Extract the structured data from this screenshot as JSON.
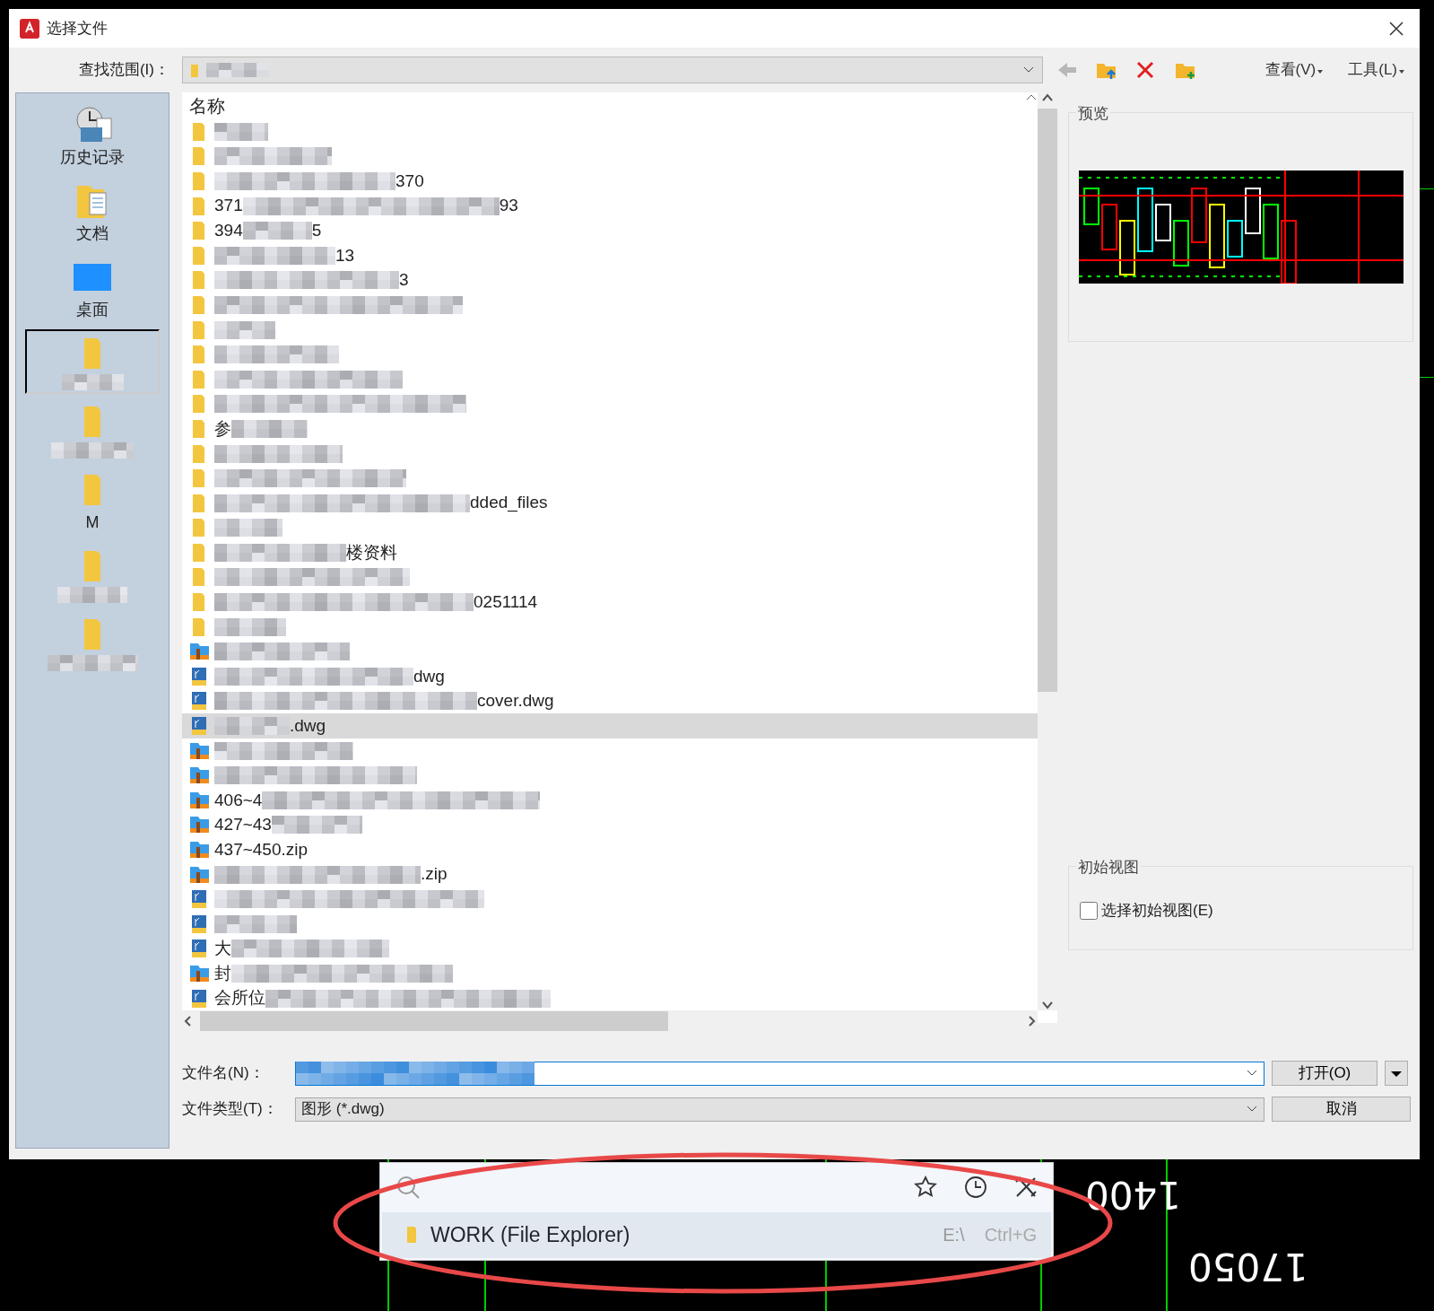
{
  "window": {
    "title": "选择文件"
  },
  "look_in": {
    "label": "查找范围(I)：",
    "value_blurred": true
  },
  "toolbar": {
    "buttons": [
      {
        "kind": "back",
        "disabled": true
      },
      {
        "kind": "up"
      },
      {
        "kind": "delete"
      },
      {
        "kind": "new-folder"
      }
    ],
    "menus": [
      {
        "label": "查看(V)"
      },
      {
        "label": "工具(L)"
      }
    ]
  },
  "sidebar": {
    "items": [
      {
        "kind": "history",
        "label": "历史记录",
        "selected": false
      },
      {
        "kind": "documents",
        "label": "文档",
        "selected": false
      },
      {
        "kind": "desktop",
        "label": "桌面",
        "selected": false
      },
      {
        "kind": "folder",
        "selected": true
      },
      {
        "kind": "folder",
        "selected": false
      },
      {
        "kind": "folder",
        "selected": false,
        "label": "M"
      },
      {
        "kind": "folder",
        "selected": false
      },
      {
        "kind": "folder",
        "selected": false
      }
    ]
  },
  "file_list": {
    "columns": [
      "名称"
    ],
    "rows": [
      {
        "kind": "folder",
        "selected": false,
        "segments": [
          {
            "kind": "blur"
          }
        ]
      },
      {
        "kind": "folder",
        "selected": false,
        "segments": [
          {
            "kind": "blur"
          }
        ]
      },
      {
        "kind": "folder",
        "selected": false,
        "segments": [
          {
            "kind": "blur"
          },
          {
            "kind": "text",
            "text": "370"
          }
        ]
      },
      {
        "kind": "folder",
        "selected": false,
        "segments": [
          {
            "kind": "text",
            "text": "371"
          },
          {
            "kind": "blur"
          },
          {
            "kind": "text",
            "text": "93"
          }
        ]
      },
      {
        "kind": "folder",
        "selected": false,
        "segments": [
          {
            "kind": "text",
            "text": "394"
          },
          {
            "kind": "blur"
          },
          {
            "kind": "text",
            "text": "5"
          }
        ]
      },
      {
        "kind": "folder",
        "selected": false,
        "segments": [
          {
            "kind": "blur"
          },
          {
            "kind": "text",
            "text": "13"
          }
        ]
      },
      {
        "kind": "folder",
        "selected": false,
        "segments": [
          {
            "kind": "blur"
          },
          {
            "kind": "text",
            "text": "3"
          }
        ]
      },
      {
        "kind": "folder",
        "selected": false,
        "segments": [
          {
            "kind": "blur"
          }
        ]
      },
      {
        "kind": "folder",
        "selected": false,
        "segments": [
          {
            "kind": "blur"
          }
        ]
      },
      {
        "kind": "folder",
        "selected": false,
        "segments": [
          {
            "kind": "blur"
          }
        ]
      },
      {
        "kind": "folder",
        "selected": false,
        "segments": [
          {
            "kind": "blur"
          }
        ]
      },
      {
        "kind": "folder",
        "selected": false,
        "segments": [
          {
            "kind": "blur"
          }
        ]
      },
      {
        "kind": "folder",
        "selected": false,
        "segments": [
          {
            "kind": "text",
            "text": "参"
          },
          {
            "kind": "blur"
          }
        ]
      },
      {
        "kind": "folder",
        "selected": false,
        "segments": [
          {
            "kind": "blur"
          }
        ]
      },
      {
        "kind": "folder",
        "selected": false,
        "segments": [
          {
            "kind": "blur"
          }
        ]
      },
      {
        "kind": "folder",
        "selected": false,
        "segments": [
          {
            "kind": "blur"
          },
          {
            "kind": "text",
            "text": "dded_files"
          }
        ]
      },
      {
        "kind": "folder",
        "selected": false,
        "segments": [
          {
            "kind": "blur"
          }
        ]
      },
      {
        "kind": "folder",
        "selected": false,
        "segments": [
          {
            "kind": "blur"
          },
          {
            "kind": "text",
            "text": "楼资料"
          }
        ]
      },
      {
        "kind": "folder",
        "selected": false,
        "segments": [
          {
            "kind": "blur"
          }
        ]
      },
      {
        "kind": "folder",
        "selected": false,
        "segments": [
          {
            "kind": "blur"
          },
          {
            "kind": "text",
            "text": "0251114"
          }
        ]
      },
      {
        "kind": "folder",
        "selected": false,
        "segments": [
          {
            "kind": "blur"
          }
        ]
      },
      {
        "kind": "zip",
        "selected": false,
        "segments": [
          {
            "kind": "blur"
          }
        ]
      },
      {
        "kind": "dwg",
        "selected": false,
        "segments": [
          {
            "kind": "blur"
          },
          {
            "kind": "text",
            "text": "dwg"
          }
        ]
      },
      {
        "kind": "dwg",
        "selected": false,
        "segments": [
          {
            "kind": "blur"
          },
          {
            "kind": "text",
            "text": "cover.dwg"
          }
        ]
      },
      {
        "kind": "dwg",
        "selected": true,
        "segments": [
          {
            "kind": "blur"
          },
          {
            "kind": "text",
            "text": ".dwg"
          }
        ]
      },
      {
        "kind": "zip",
        "selected": false,
        "segments": [
          {
            "kind": "blur"
          }
        ]
      },
      {
        "kind": "zip",
        "selected": false,
        "segments": [
          {
            "kind": "blur"
          }
        ]
      },
      {
        "kind": "zip",
        "selected": false,
        "segments": [
          {
            "kind": "text",
            "text": "406~4"
          },
          {
            "kind": "blur"
          }
        ]
      },
      {
        "kind": "zip",
        "selected": false,
        "segments": [
          {
            "kind": "text",
            "text": "427~43"
          },
          {
            "kind": "blur"
          }
        ]
      },
      {
        "kind": "zip",
        "selected": false,
        "segments": [
          {
            "kind": "text",
            "text": "437~450.zip"
          }
        ]
      },
      {
        "kind": "zip",
        "selected": false,
        "segments": [
          {
            "kind": "blur"
          },
          {
            "kind": "text",
            "text": ".zip"
          }
        ]
      },
      {
        "kind": "dwg",
        "selected": false,
        "segments": [
          {
            "kind": "blur"
          }
        ]
      },
      {
        "kind": "dwg",
        "selected": false,
        "segments": [
          {
            "kind": "blur"
          }
        ]
      },
      {
        "kind": "dwg",
        "selected": false,
        "segments": [
          {
            "kind": "text",
            "text": "大"
          },
          {
            "kind": "blur"
          }
        ]
      },
      {
        "kind": "zip",
        "selected": false,
        "segments": [
          {
            "kind": "text",
            "text": "封"
          },
          {
            "kind": "blur"
          }
        ]
      },
      {
        "kind": "dwg",
        "selected": false,
        "segments": [
          {
            "kind": "text",
            "text": "会所位"
          },
          {
            "kind": "blur"
          }
        ]
      }
    ]
  },
  "preview": {
    "title": "预览"
  },
  "initial_view": {
    "title": "初始视图",
    "checkbox": {
      "label": "选择初始视图(E)",
      "checked": false
    }
  },
  "file_name": {
    "label": "文件名(N)：",
    "value_blurred": true
  },
  "file_type": {
    "label": "文件类型(T)：",
    "value": "图形 (*.dwg)"
  },
  "buttons": [
    {
      "label": "打开(O)",
      "kind": "split"
    },
    {
      "label": "取消",
      "kind": "plain"
    }
  ],
  "launcher": {
    "result": {
      "name": "WORK (File Explorer)",
      "path": "E:\\",
      "shortcut": "Ctrl+G",
      "selected": true
    }
  },
  "canvas_labels": [
    "1400",
    "17050"
  ]
}
